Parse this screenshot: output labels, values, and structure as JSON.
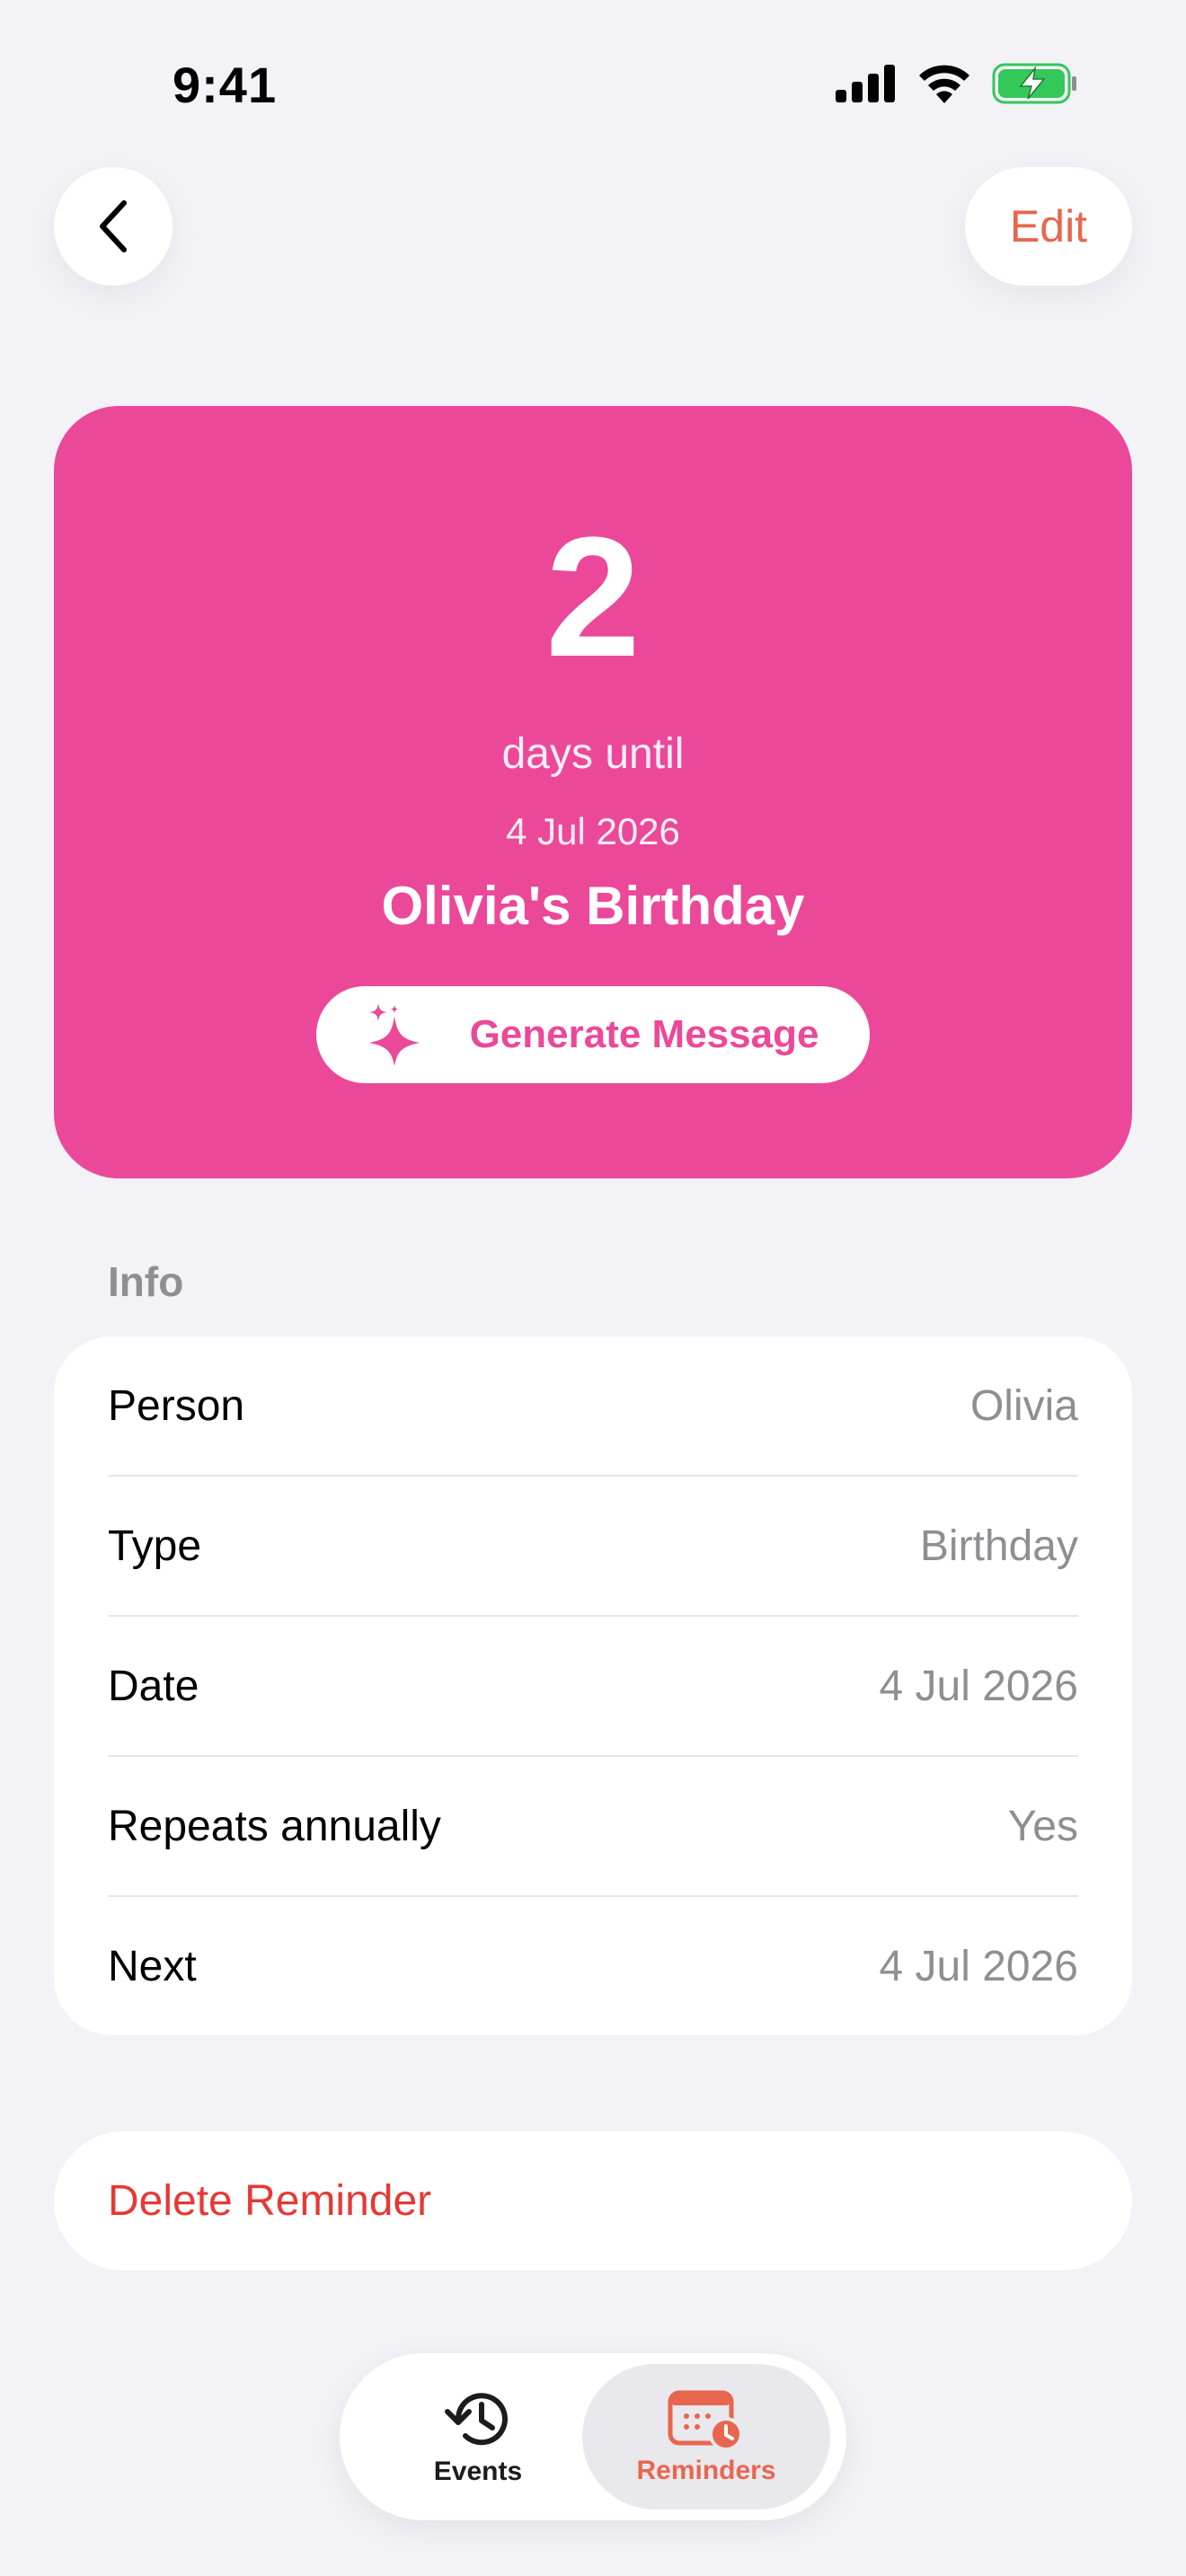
{
  "status_bar": {
    "time": "9:41"
  },
  "nav": {
    "edit_label": "Edit"
  },
  "hero": {
    "count": "2",
    "subtitle": "days until",
    "date": "4 Jul 2026",
    "title": "Olivia's Birthday",
    "generate_label": "Generate Message",
    "color": "#EC4899"
  },
  "info": {
    "header": "Info",
    "rows": [
      {
        "label": "Person",
        "value": "Olivia"
      },
      {
        "label": "Type",
        "value": "Birthday"
      },
      {
        "label": "Date",
        "value": "4 Jul 2026"
      },
      {
        "label": "Repeats annually",
        "value": "Yes"
      },
      {
        "label": "Next",
        "value": "4 Jul 2026"
      }
    ]
  },
  "delete_label": "Delete Reminder",
  "tabbar": {
    "tabs": [
      {
        "label": "Events",
        "icon": "history-clock-icon",
        "selected": false
      },
      {
        "label": "Reminders",
        "icon": "calendar-clock-icon",
        "selected": true
      }
    ]
  },
  "colors": {
    "accent": "#E8664E",
    "destructive": "#E53935",
    "background": "#F2F2F7"
  }
}
